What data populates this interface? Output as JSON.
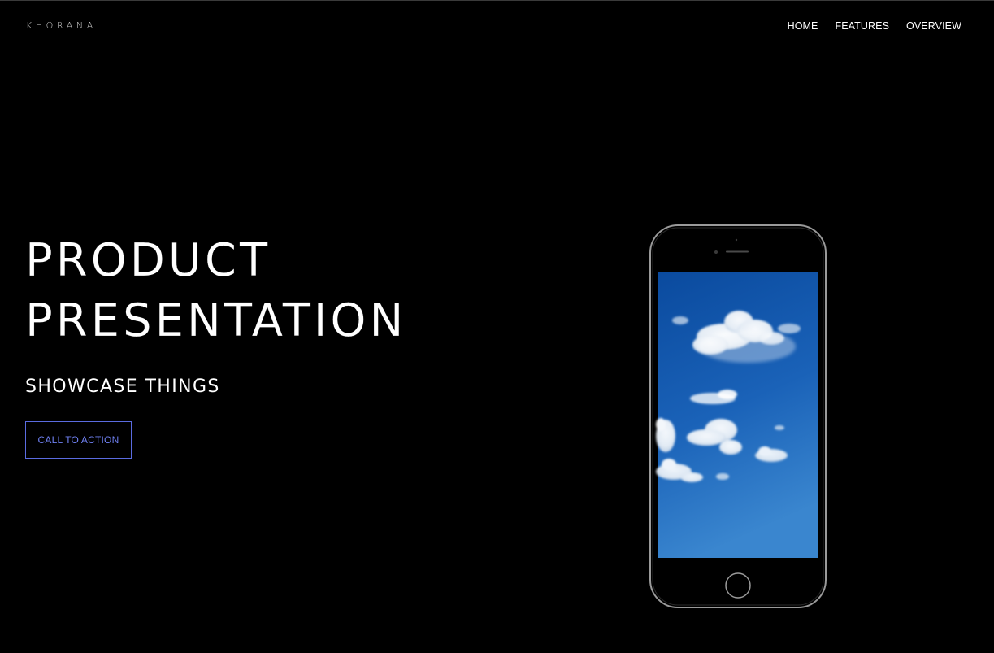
{
  "header": {
    "brand": "KHORANA",
    "nav": [
      {
        "label": "HOME"
      },
      {
        "label": "FEATURES"
      },
      {
        "label": "OVERVIEW"
      }
    ]
  },
  "hero": {
    "title_line_1": "PRODUCT",
    "title_line_2": "PRESENTATION",
    "subtitle": "SHOWCASE THINGS",
    "cta_label": "CALL TO ACTION"
  },
  "device": {
    "type": "smartphone",
    "screen_content": "blue sky with clouds",
    "colors": {
      "body": "#000000",
      "frame": "#9a9a9a",
      "sky_top": "#0a4a9e",
      "sky_bottom": "#3a86cf"
    }
  },
  "colors": {
    "background": "#000000",
    "text": "#ffffff",
    "accent": "#6f80f2"
  }
}
